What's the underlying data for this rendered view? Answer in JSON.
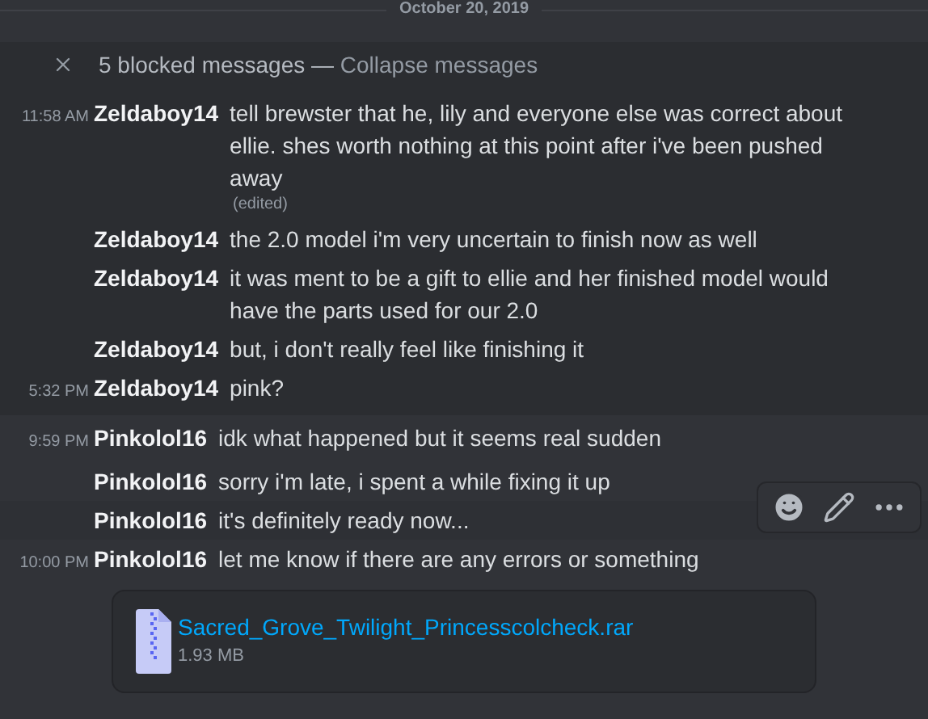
{
  "date_divider": "October 20, 2019",
  "blocked": {
    "summary": "5 blocked messages — ",
    "action": "Collapse messages",
    "expanded": true,
    "messages": [
      {
        "time": "11:58 AM",
        "author": "Zeldaboy14",
        "text": "tell brewster that he, lily and everyone else was correct about ellie. shes worth nothing at this point after i've been pushed away",
        "edited": "(edited)"
      },
      {
        "author": "Zeldaboy14",
        "text": "the 2.0 model i'm very uncertain to finish now as well"
      },
      {
        "author": "Zeldaboy14",
        "text": "it was ment to be a gift to ellie and her finished model would have the parts used for our 2.0"
      },
      {
        "author": "Zeldaboy14",
        "text": "but, i don't really feel like finishing it"
      },
      {
        "time": "5:32 PM",
        "author": "Zeldaboy14",
        "text": "pink?"
      }
    ]
  },
  "messages": [
    {
      "time": "9:59 PM",
      "author": "Pinkolol16",
      "text": "idk what happened but it seems real sudden",
      "hovered": false
    },
    {
      "author": "Pinkolol16",
      "text": "sorry i'm late, i spent a while fixing it up",
      "hovered": false
    },
    {
      "author": "Pinkolol16",
      "text": "it's definitely ready now...",
      "hovered": true
    },
    {
      "time": "10:00 PM",
      "author": "Pinkolol16",
      "text": "let me know if there are any errors or something",
      "hovered": false,
      "attachment": {
        "name": "Sacred_Grove_Twilight_Princesscolcheck.rar",
        "size": "1.93 MB"
      }
    }
  ]
}
